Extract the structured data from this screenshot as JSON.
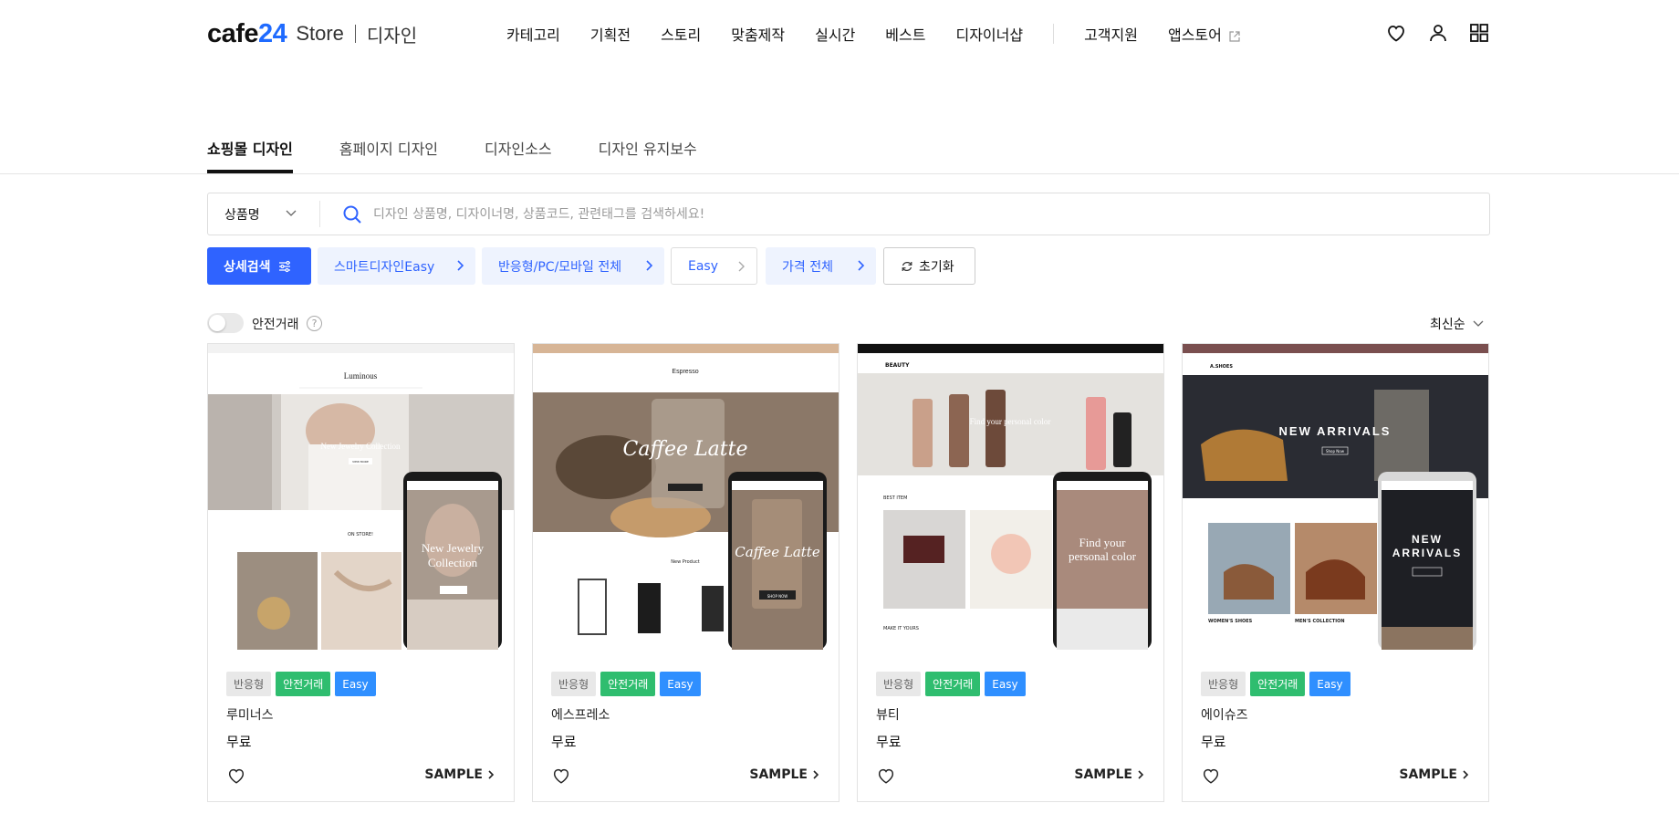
{
  "header": {
    "logo_cafe": "cafe",
    "logo_24": "24",
    "logo_store": "Store",
    "logo_design": "디자인",
    "nav": [
      "카테고리",
      "기획전",
      "스토리",
      "맞춤제작",
      "실시간",
      "베스트",
      "디자이너샵"
    ],
    "nav_right": [
      "고객지원",
      "앱스토어"
    ],
    "icons": [
      "heart-icon",
      "user-icon",
      "grid-icon"
    ]
  },
  "tabs": [
    "쇼핑몰 디자인",
    "홈페이지 디자인",
    "디자인소스",
    "디자인 유지보수"
  ],
  "search": {
    "select_value": "상품명",
    "placeholder": "디자인 상품명, 디자이너명, 상품코드, 관련태그를 검색하세요!"
  },
  "filters": {
    "detail": "상세검색",
    "smart": "스마트디자인Easy",
    "device": "반응형/PC/모바일 전체",
    "easy": "Easy",
    "price": "가격 전체",
    "reset": "초기화"
  },
  "toolbar": {
    "safe_trade": "안전거래",
    "help": "?",
    "sort": "최신순"
  },
  "colors": {
    "accent": "#2f63ff",
    "green": "#2fbd6f",
    "blue": "#2f8fff"
  },
  "cards": [
    {
      "name": "루미너스",
      "price": "무료",
      "sample": "SAMPLE",
      "badges": [
        "반응형",
        "안전거래",
        "Easy"
      ],
      "preview": {
        "brand": "Luminous",
        "hero": "New Jewelry Collection",
        "mobile_hero": "New Jewelry Collection",
        "button": "VIEW MORE",
        "section": "ON STORE!"
      }
    },
    {
      "name": "에스프레소",
      "price": "무료",
      "sample": "SAMPLE",
      "badges": [
        "반응형",
        "안전거래",
        "Easy"
      ],
      "preview": {
        "brand": "Espresso",
        "hero": "Caffee Latte",
        "mobile_hero": "Caffee Latte",
        "button": "SHOP NOW",
        "section": "New Product"
      }
    },
    {
      "name": "뷰티",
      "price": "무료",
      "sample": "SAMPLE",
      "badges": [
        "반응형",
        "안전거래",
        "Easy"
      ],
      "preview": {
        "brand": "BEAUTY",
        "hero": "Find your personal color",
        "mobile_hero": "Find your personal color",
        "section": "BEST ITEM",
        "section2": "MAKE IT YOURS"
      }
    },
    {
      "name": "에이슈즈",
      "price": "무료",
      "sample": "SAMPLE",
      "badges": [
        "반응형",
        "안전거래",
        "Easy"
      ],
      "preview": {
        "brand": "A.SHOES",
        "hero": "NEW ARRIVALS",
        "mobile_hero": "NEW ARRIVALS",
        "button": "Shop Now",
        "section": "WOMEN'S SHOES",
        "section2": "MEN'S COLLECTION"
      }
    }
  ]
}
